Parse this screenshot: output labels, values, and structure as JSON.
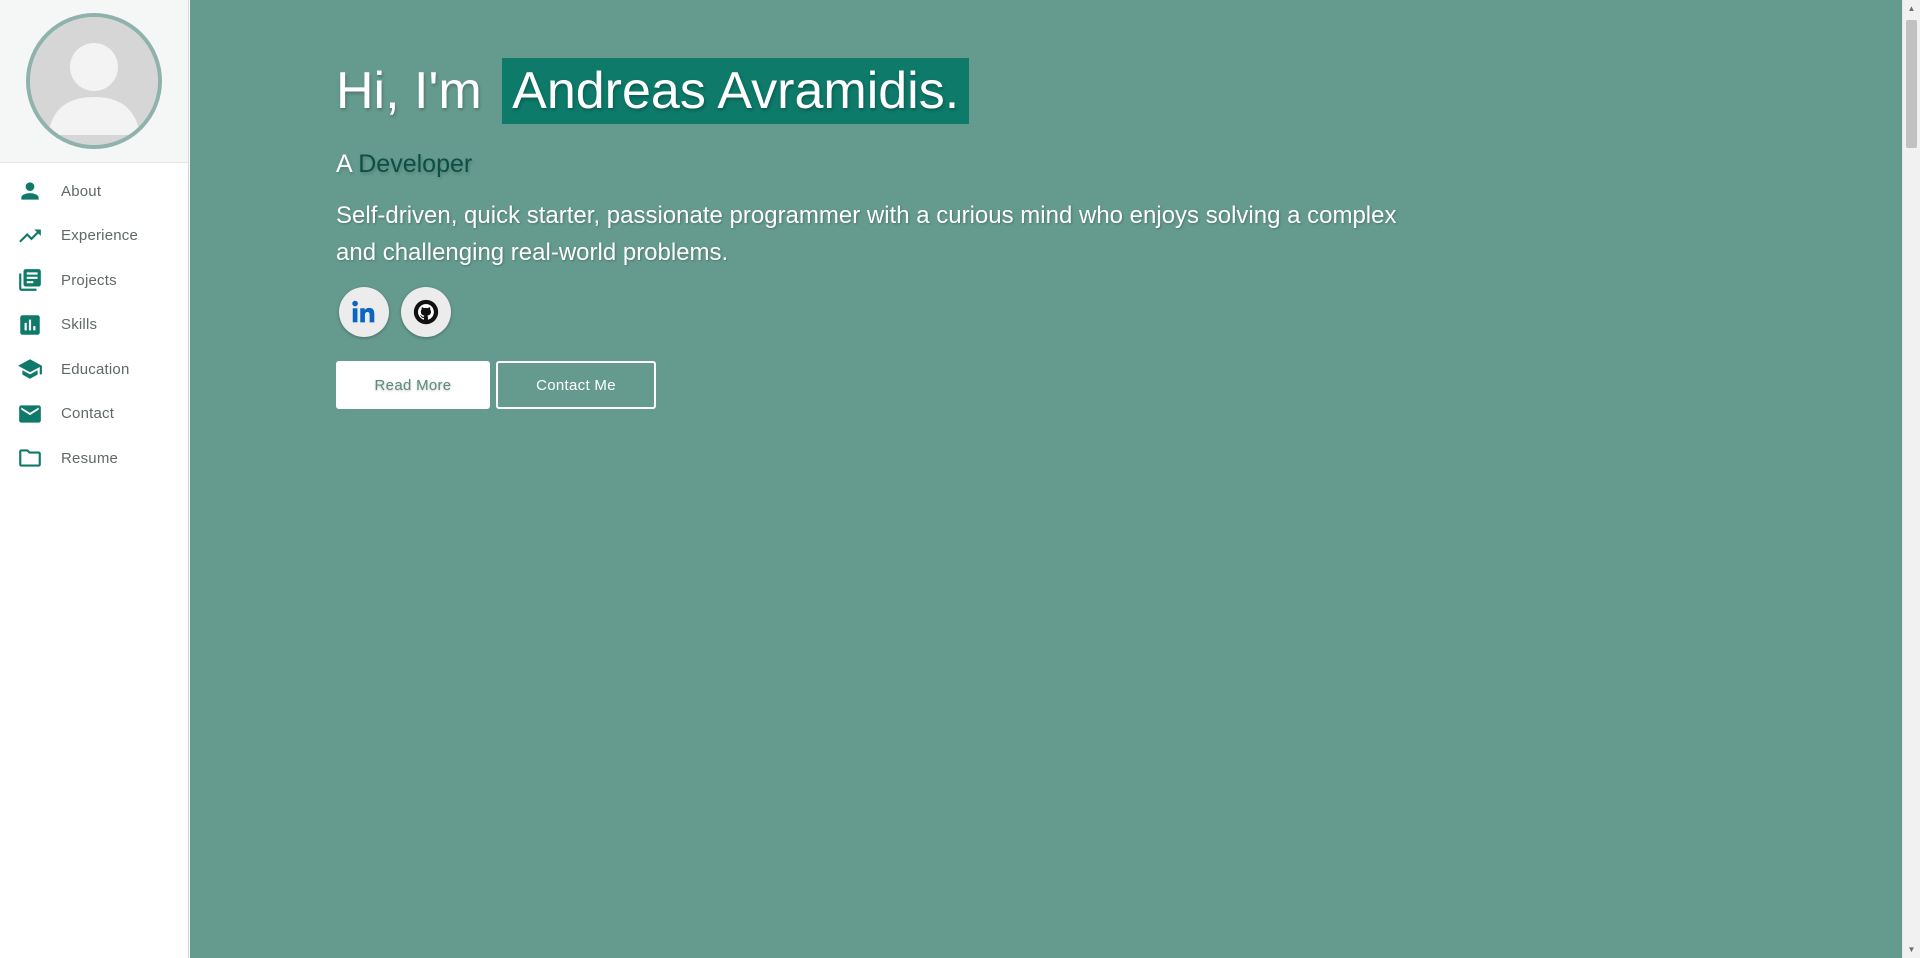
{
  "sidebar": {
    "avatar_icon": "user-placeholder",
    "items": [
      {
        "label": "About",
        "icon": "person-icon"
      },
      {
        "label": "Experience",
        "icon": "trending-up-icon"
      },
      {
        "label": "Projects",
        "icon": "library-books-icon"
      },
      {
        "label": "Skills",
        "icon": "bar-chart-icon"
      },
      {
        "label": "Education",
        "icon": "school-icon"
      },
      {
        "label": "Contact",
        "icon": "mail-icon"
      },
      {
        "label": "Resume",
        "icon": "folder-icon"
      }
    ]
  },
  "hero": {
    "greeting": "Hi, I'm",
    "name": "Andreas Avramidis.",
    "subtitle_prefix": "A",
    "role": "Developer",
    "description": "Self-driven, quick starter, passionate programmer with a curious mind who enjoys solving a complex and challenging real-world problems.",
    "socials": [
      {
        "icon": "linkedin-icon"
      },
      {
        "icon": "github-icon"
      }
    ],
    "read_more_label": "Read More",
    "contact_label": "Contact Me"
  },
  "colors": {
    "hero_background": "#659b8e",
    "accent": "#0d7a6a",
    "role_text": "#0b4f45",
    "icon": "#0f7a6a"
  }
}
